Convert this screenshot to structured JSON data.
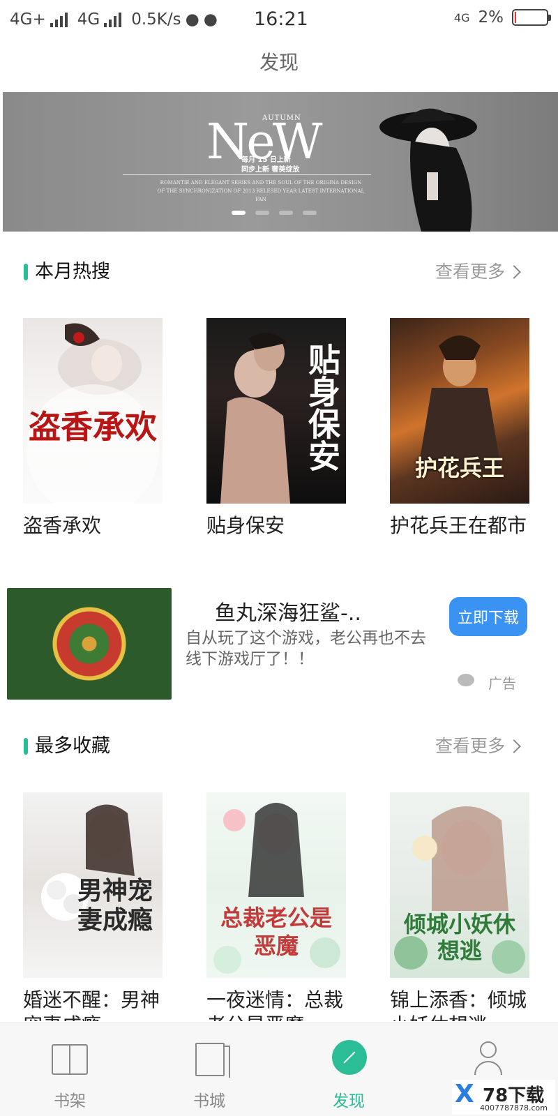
{
  "status": {
    "net1": "4G+",
    "net2": "4G",
    "speed": "0.5K/s",
    "time": "16:21",
    "net_right": "4G",
    "battery": "2%"
  },
  "header": {
    "title": "发现"
  },
  "banner": {
    "new_text": "NeW",
    "autumn": "AUTUMN",
    "cn_line1": "每月 15 日上新",
    "cn_line2": "同步上新  奢美绽放",
    "en_lines": "ROMANTIE AND ELEGANT SERIES AND THE SOUL OF THE ORIGINA DESIGN OF THE SYNCHRONIZATION OF 2013 RELESED YEAR LATEST INTERNATIONAL FAN",
    "active_slide": 1,
    "slide_count": 4
  },
  "sections": [
    {
      "title": "本月热搜",
      "more": "查看更多",
      "books": [
        {
          "title": "盗香承欢",
          "cover_text": "盗香承欢"
        },
        {
          "title": "贴身保安",
          "cover_text": "贴身保安"
        },
        {
          "title": "护花兵王在都市",
          "cover_text": "护花兵王"
        }
      ]
    },
    {
      "title": "最多收藏",
      "more": "查看更多",
      "books": [
        {
          "title": "婚迷不醒：男神宠妻成瘾",
          "cover_text": "男神宠妻成瘾"
        },
        {
          "title": "一夜迷情：总裁老公是恶魔",
          "cover_text": "总裁老公是恶魔"
        },
        {
          "title": "锦上添香：倾城小妖休想逃",
          "cover_text": "倾城小妖休想逃"
        }
      ]
    }
  ],
  "ad": {
    "title": "鱼丸深海狂鲨-..",
    "desc": "自从玩了这个游戏，老公再也不去线下游戏厅了！！",
    "button": "立即下载",
    "label": "广告"
  },
  "nav": [
    {
      "label": "书架",
      "active": false
    },
    {
      "label": "书城",
      "active": false
    },
    {
      "label": "发现",
      "active": true
    },
    {
      "label": "我的",
      "active": false
    }
  ],
  "watermark": {
    "brand": "78下载",
    "url": "4007787878.com"
  },
  "colors": {
    "accent": "#2bbd95",
    "ad_button": "#3a93f2"
  }
}
